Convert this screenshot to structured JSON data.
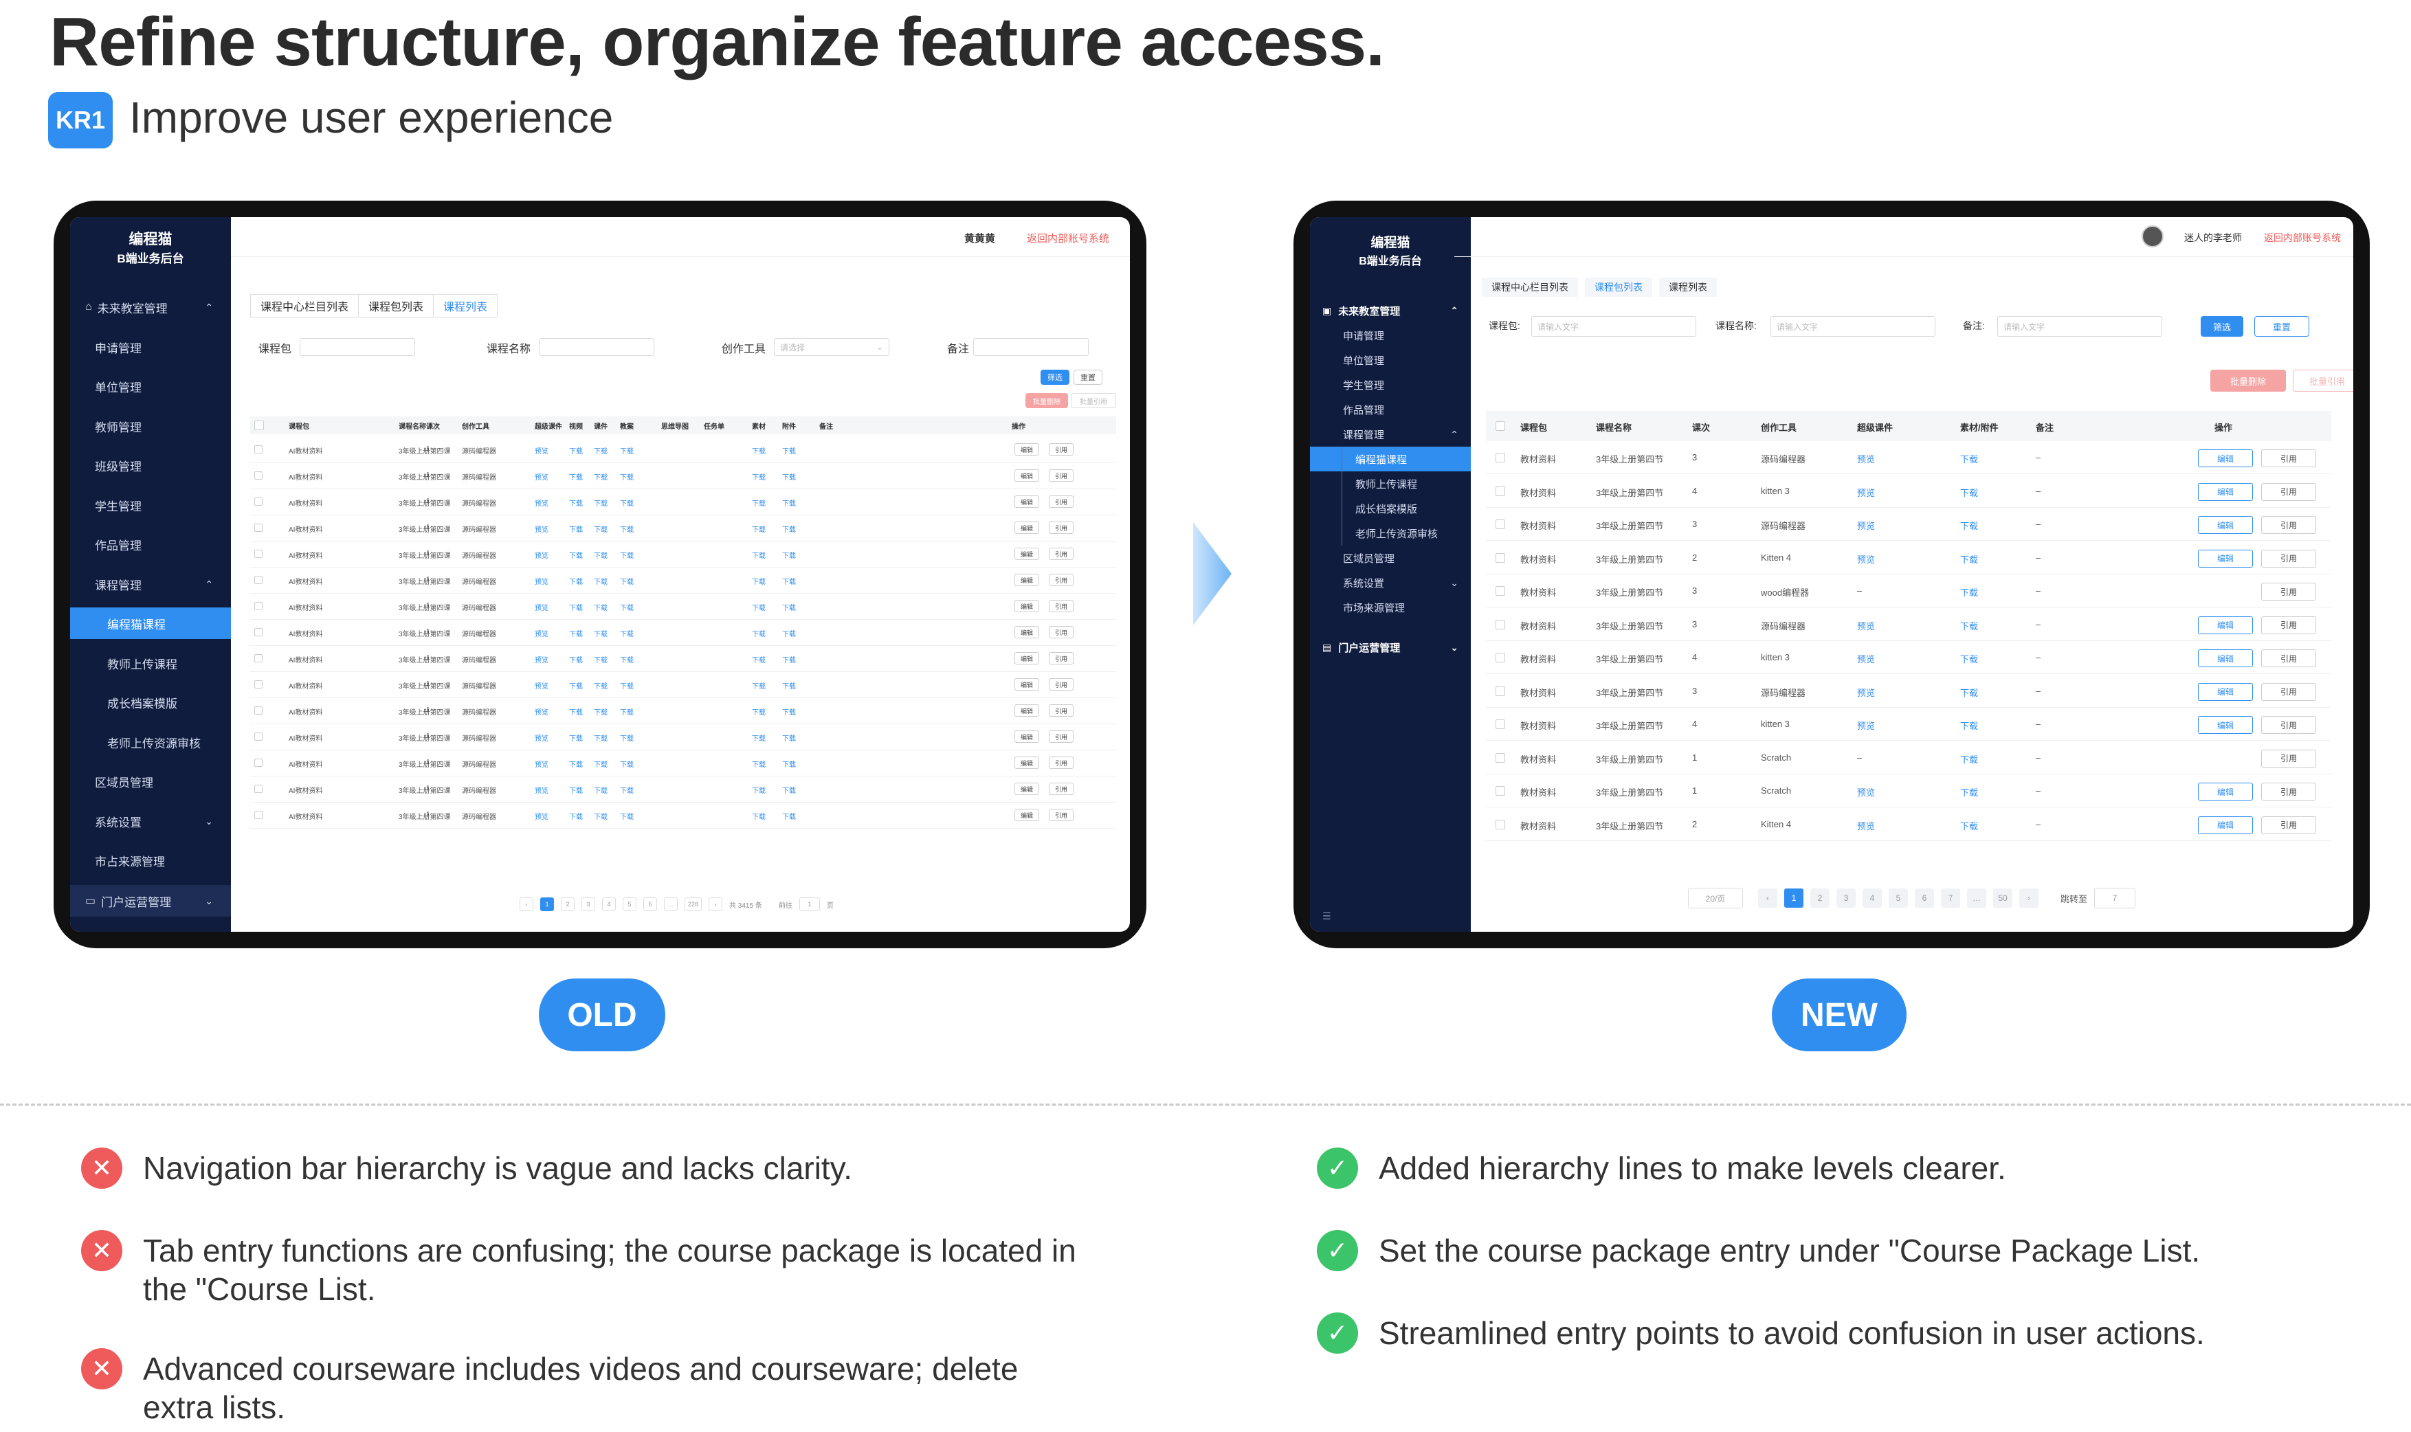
{
  "headline": "Refine structure, organize feature access.",
  "kr": {
    "badge": "KR1",
    "title": "Improve user experience"
  },
  "old": {
    "label": "OLD",
    "logo_line1": "编程猫",
    "logo_line2": "B端业务后台",
    "nav": [
      {
        "label": "未来教室管理",
        "chevron": "⌃"
      },
      {
        "label": "申请管理"
      },
      {
        "label": "单位管理"
      },
      {
        "label": "教师管理"
      },
      {
        "label": "班级管理"
      },
      {
        "label": "学生管理"
      },
      {
        "label": "作品管理"
      },
      {
        "label": "课程管理",
        "chevron": "⌃"
      },
      {
        "label": "编程猫课程",
        "active": true
      },
      {
        "label": "教师上传课程"
      },
      {
        "label": "成长档案模版"
      },
      {
        "label": "老师上传资源审核"
      },
      {
        "label": "区域员管理"
      },
      {
        "label": "系统设置",
        "chevron": "⌄"
      },
      {
        "label": "市占来源管理"
      },
      {
        "label": "门户运营管理",
        "chevron": "⌄"
      }
    ],
    "top_user": "黄黄黄",
    "top_link": "返回内部账号系统",
    "tabs": [
      "课程中心栏目列表",
      "课程包列表",
      "课程列表"
    ],
    "filters": {
      "pkg": "课程包",
      "name": "课程名称",
      "tool": "创作工具",
      "tool_ph": "请选择",
      "note": "备注",
      "filter_btn": "筛选",
      "reset_btn": "重置",
      "batch_del": "批量删除",
      "batch_quote": "批量引用"
    },
    "columns": [
      "课程包",
      "课程名称",
      "课次",
      "创作工具",
      "超级课件",
      "视频",
      "课件",
      "教案",
      "思维导图",
      "任务单",
      "素材",
      "附件",
      "备注",
      "操作"
    ],
    "row": {
      "pkg": "AI教材资料",
      "name": "3年级上册第四课",
      "n": "1",
      "tool": "源码编程器",
      "preview": "预览",
      "dl": "下载",
      "edit": "编辑",
      "quote": "引用"
    },
    "row_count": 15,
    "pager": {
      "pages": [
        "‹",
        "1",
        "2",
        "3",
        "4",
        "5",
        "6",
        "…",
        "228",
        "›"
      ],
      "total": "共 3415 条",
      "goto": "前往",
      "goto_val": "1",
      "page_unit": "页"
    }
  },
  "new": {
    "label": "NEW",
    "logo_line1": "编程猫",
    "logo_line2": "B端业务后台",
    "nav": [
      {
        "label": "未来教室管理",
        "chevron": "⌃",
        "group": true
      },
      {
        "label": "申请管理"
      },
      {
        "label": "单位管理"
      },
      {
        "label": "学生管理"
      },
      {
        "label": "作品管理"
      },
      {
        "label": "课程管理",
        "chevron": "⌃"
      },
      {
        "label": "编程猫课程",
        "active": true,
        "sub": true
      },
      {
        "label": "教师上传课程",
        "sub": true
      },
      {
        "label": "成长档案模版",
        "sub": true
      },
      {
        "label": "老师上传资源审核",
        "sub": true
      },
      {
        "label": "区域员管理"
      },
      {
        "label": "系统设置",
        "chevron": "⌄"
      },
      {
        "label": "市场来源管理"
      },
      {
        "label": "门户运营管理",
        "chevron": "⌄",
        "group": true
      }
    ],
    "top_user": "迷人的李老师",
    "top_link": "返回内部账号系统",
    "tabs": [
      "课程中心栏目列表",
      "课程包列表",
      "课程列表"
    ],
    "filters": {
      "pkg": "课程包:",
      "pkg_ph": "请输入文字",
      "name": "课程名称:",
      "name_ph": "请输入文字",
      "note": "备注:",
      "note_ph": "请输入文字",
      "filter_btn": "筛选",
      "reset_btn": "重置",
      "batch_del": "批量删除",
      "batch_quote": "批量引用"
    },
    "columns": [
      "课程包",
      "课程名称",
      "课次",
      "创作工具",
      "超级课件",
      "素材/附件",
      "备注",
      "操作"
    ],
    "rows": [
      {
        "pkg": "教材资料",
        "name": "3年级上册第四节",
        "n": "3",
        "tool": "源码编程器",
        "preview": "预览",
        "dl": "下载",
        "note": "–",
        "edit": "编辑",
        "quote": "引用"
      },
      {
        "pkg": "教材资料",
        "name": "3年级上册第四节",
        "n": "4",
        "tool": "kitten 3",
        "preview": "预览",
        "dl": "下载",
        "note": "–",
        "edit": "编辑",
        "quote": "引用"
      },
      {
        "pkg": "教材资料",
        "name": "3年级上册第四节",
        "n": "3",
        "tool": "源码编程器",
        "preview": "预览",
        "dl": "下载",
        "note": "–",
        "edit": "编辑",
        "quote": "引用"
      },
      {
        "pkg": "教材资料",
        "name": "3年级上册第四节",
        "n": "2",
        "tool": "Kitten 4",
        "preview": "预览",
        "dl": "下载",
        "note": "–",
        "edit": "编辑",
        "quote": "引用"
      },
      {
        "pkg": "教材资料",
        "name": "3年级上册第四节",
        "n": "3",
        "tool": "wood编程器",
        "preview": "–",
        "dl": "下载",
        "note": "–",
        "edit": "",
        "quote": "引用"
      },
      {
        "pkg": "教材资料",
        "name": "3年级上册第四节",
        "n": "3",
        "tool": "源码编程器",
        "preview": "预览",
        "dl": "下载",
        "note": "–",
        "edit": "编辑",
        "quote": "引用"
      },
      {
        "pkg": "教材资料",
        "name": "3年级上册第四节",
        "n": "4",
        "tool": "kitten 3",
        "preview": "预览",
        "dl": "下载",
        "note": "–",
        "edit": "编辑",
        "quote": "引用"
      },
      {
        "pkg": "教材资料",
        "name": "3年级上册第四节",
        "n": "3",
        "tool": "源码编程器",
        "preview": "预览",
        "dl": "下载",
        "note": "–",
        "edit": "编辑",
        "quote": "引用"
      },
      {
        "pkg": "教材资料",
        "name": "3年级上册第四节",
        "n": "4",
        "tool": "kitten 3",
        "preview": "预览",
        "dl": "下载",
        "note": "–",
        "edit": "编辑",
        "quote": "引用"
      },
      {
        "pkg": "教材资料",
        "name": "3年级上册第四节",
        "n": "1",
        "tool": "Scratch",
        "preview": "–",
        "dl": "下载",
        "note": "–",
        "edit": "",
        "quote": "引用"
      },
      {
        "pkg": "教材资料",
        "name": "3年级上册第四节",
        "n": "1",
        "tool": "Scratch",
        "preview": "预览",
        "dl": "下载",
        "note": "–",
        "edit": "编辑",
        "quote": "引用"
      },
      {
        "pkg": "教材资料",
        "name": "3年级上册第四节",
        "n": "2",
        "tool": "Kitten 4",
        "preview": "预览",
        "dl": "下载",
        "note": "–",
        "edit": "编辑",
        "quote": "引用"
      }
    ],
    "pager": {
      "size": "20/页",
      "pages": [
        "‹",
        "1",
        "2",
        "3",
        "4",
        "5",
        "6",
        "7",
        "…",
        "50",
        "›"
      ],
      "goto": "跳转至",
      "goto_val": "7"
    }
  },
  "issues": [
    "Navigation bar hierarchy is vague and lacks clarity.",
    "Tab entry functions are confusing; the course package is located in the \"Course List.",
    "Advanced courseware includes videos and courseware; delete extra lists."
  ],
  "fixes": [
    "Added hierarchy lines to make levels clearer.",
    "Set the course package entry under \"Course Package List.",
    "Streamlined entry points to avoid confusion in user actions."
  ],
  "colors": {
    "accent": "#2f8ef0",
    "sidebar": "#0f1c3d",
    "error": "#ef5a5a",
    "success": "#3cc46a"
  }
}
